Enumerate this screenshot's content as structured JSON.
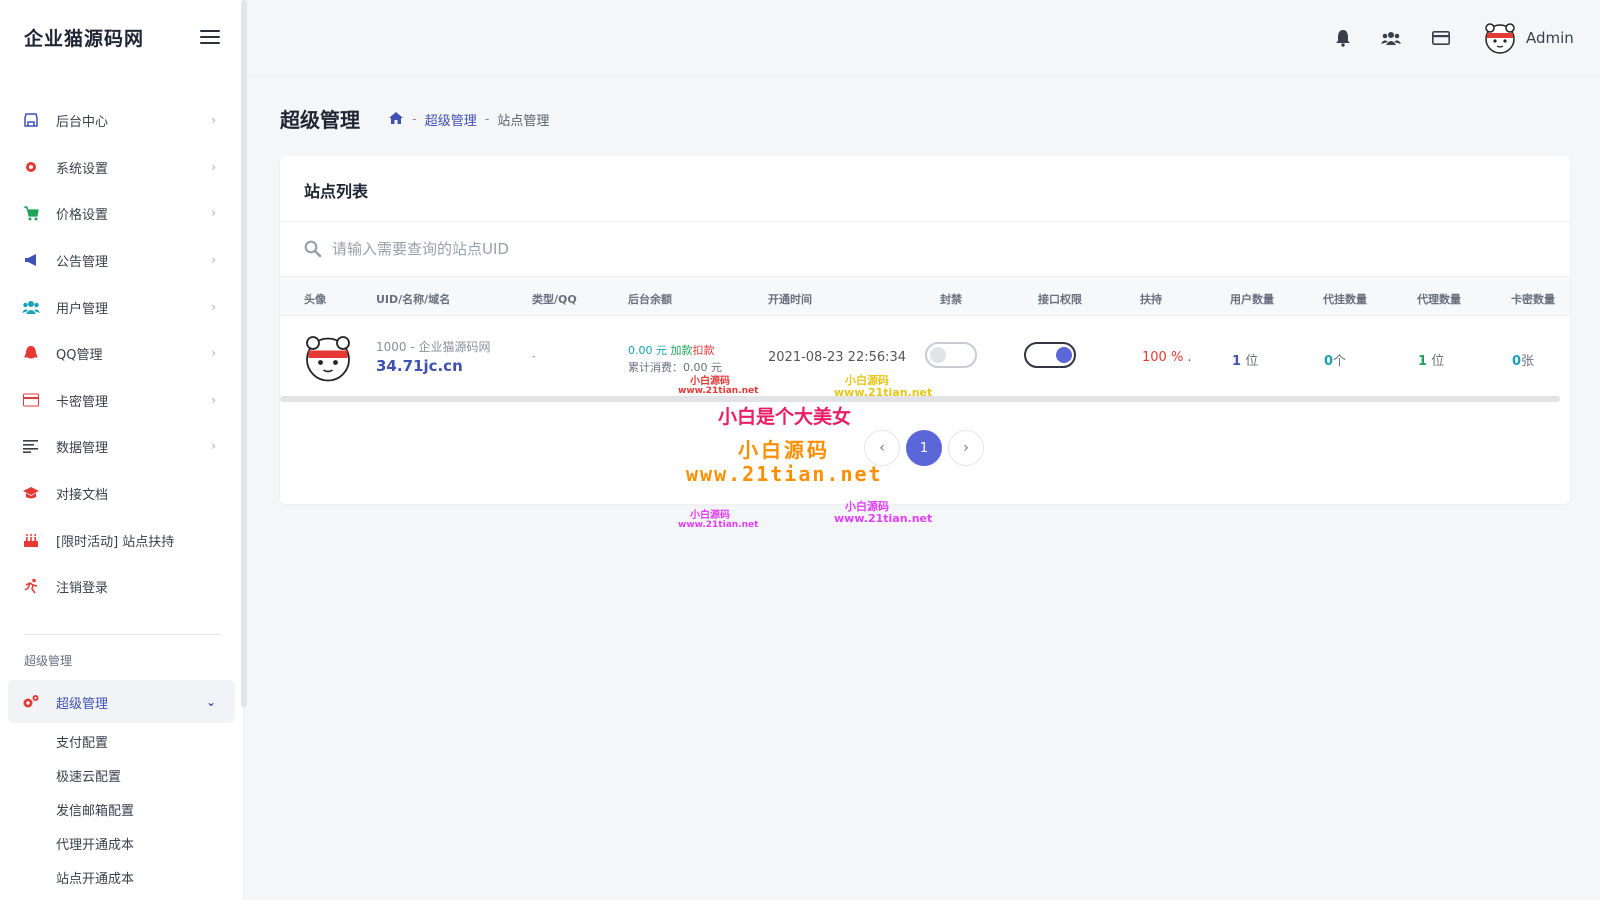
{
  "brand": "企业猫源码网",
  "sidebar": {
    "items": [
      {
        "label": "后台中心",
        "icon": "store-icon",
        "color": "#3f51b5"
      },
      {
        "label": "系统设置",
        "icon": "gear-icon",
        "color": "#e53935"
      },
      {
        "label": "价格设置",
        "icon": "cart-icon",
        "color": "#20a35a"
      },
      {
        "label": "公告管理",
        "icon": "megaphone-icon",
        "color": "#3f51b5"
      },
      {
        "label": "用户管理",
        "icon": "users-icon",
        "color": "#17a2b8"
      },
      {
        "label": "QQ管理",
        "icon": "qq-icon",
        "color": "#e53935"
      },
      {
        "label": "卡密管理",
        "icon": "card-icon",
        "color": "#e53935"
      },
      {
        "label": "数据管理",
        "icon": "list-icon",
        "color": "#3a3f4b"
      },
      {
        "label": "对接文档",
        "icon": "graduation-cap-icon",
        "color": "#e53935"
      },
      {
        "label": "[限时活动] 站点扶持",
        "icon": "cake-icon",
        "color": "#e53935"
      },
      {
        "label": "注销登录",
        "icon": "run-icon",
        "color": "#e53935"
      }
    ],
    "section_label": "超级管理",
    "active_item": {
      "label": "超级管理",
      "icon": "gears-icon",
      "color": "#e53935"
    },
    "sub_items": [
      "支付配置",
      "极速云配置",
      "发信邮箱配置",
      "代理开通成本",
      "站点开通成本"
    ]
  },
  "header": {
    "icons": [
      "bell-icon",
      "users-icon",
      "credit-card-icon"
    ],
    "user": "Admin"
  },
  "page": {
    "title": "超级管理",
    "breadcrumb": [
      "超级管理",
      "站点管理"
    ]
  },
  "card": {
    "title": "站点列表",
    "search_placeholder": "请输入需要查询的站点UID",
    "columns": [
      "头像",
      "UID/名称/域名",
      "类型/QQ",
      "后台余额",
      "开通时间",
      "封禁",
      "接口权限",
      "扶持",
      "用户数量",
      "代挂数量",
      "代理数量",
      "卡密数量"
    ],
    "rows": [
      {
        "uid_name": "1000 - 企业猫源码网",
        "domain": "34.71jc.cn",
        "type_qq": "-",
        "balance": "0.00 元",
        "balance_add": "加款",
        "balance_sub": "扣款",
        "consumed": "累计消费：0.00 元",
        "open_time": "2021-08-23 22:56:34",
        "banned": false,
        "api_permission": true,
        "support": "100 % .",
        "user_count": "1",
        "user_unit": "位",
        "hang_count": "0",
        "hang_unit": "个",
        "agent_count": "1",
        "agent_unit": "位",
        "card_count": "0",
        "card_unit": "张"
      }
    ],
    "pagination": {
      "prev": "‹",
      "current": "1",
      "next": "›"
    }
  },
  "watermarks": [
    "小白源码",
    "www.21tian.net",
    "小白源码",
    "www.21tian.net",
    "小白是个大美女",
    "小白源码",
    "www.21tian.net",
    "小白源码",
    "www.21tian.net",
    "小白源码",
    "www.21tian.net"
  ],
  "colors": {
    "accent": "#5b67d8",
    "primary": "#3f51b5",
    "danger": "#e53935",
    "info": "#17a2b8",
    "success": "#20a35a"
  }
}
